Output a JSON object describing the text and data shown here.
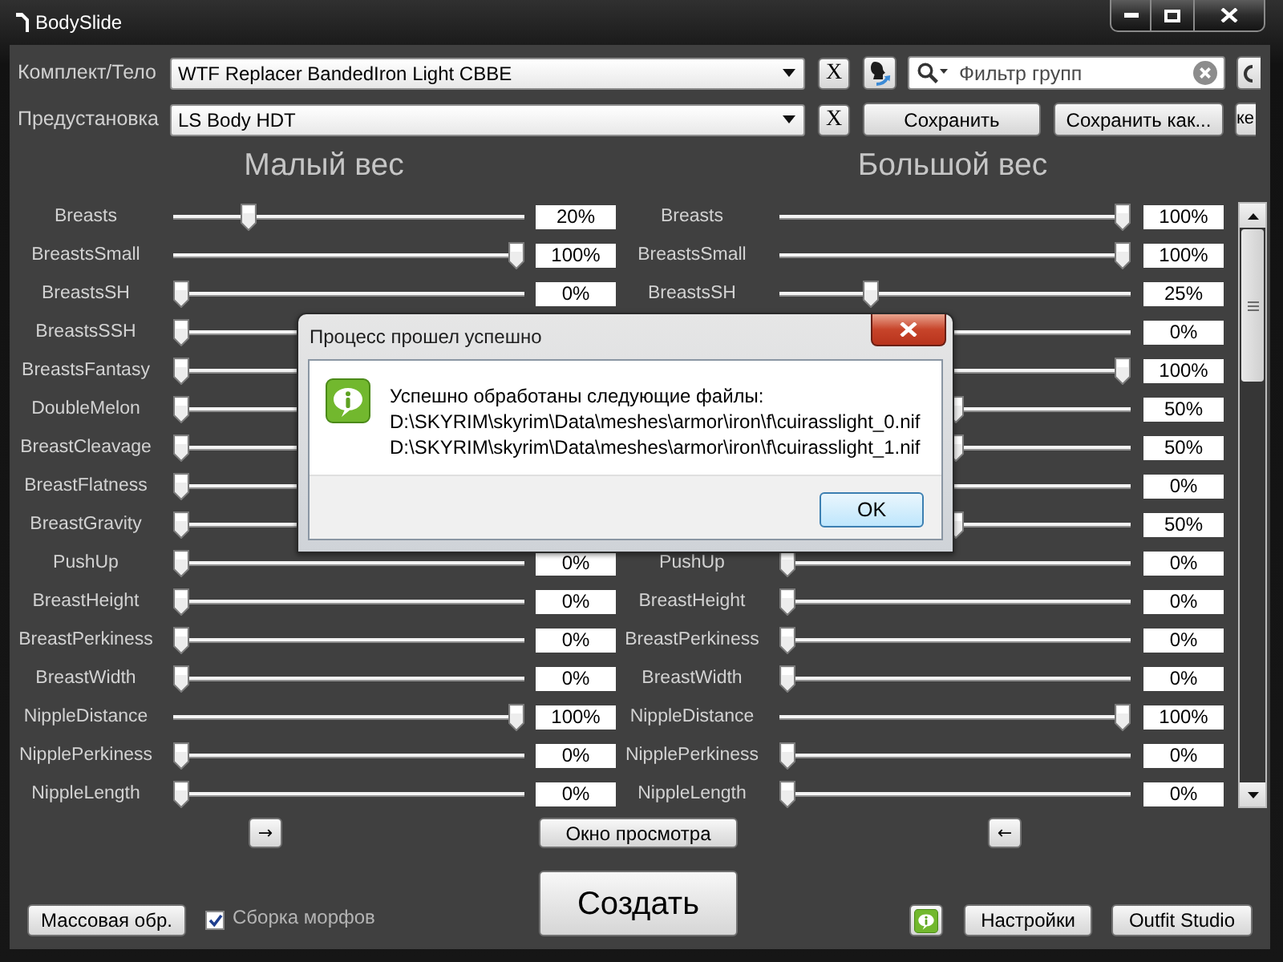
{
  "window": {
    "title": "BodySlide"
  },
  "outfit": {
    "label": "Комплект/Тело",
    "value": "WTF Replacer BandedIron Light CBBE",
    "clear_button": "X"
  },
  "group_filter": {
    "placeholder": "Фильтр групп"
  },
  "preset": {
    "label": "Предустановка",
    "value": "LS Body HDT",
    "clear_button": "X",
    "buttons": [
      "Сохранить",
      "Сохранить как...",
      "ке"
    ]
  },
  "column_headers": [
    "Малый вес",
    "Большой вес"
  ],
  "sliders": [
    {
      "low": {
        "label": "Breasts",
        "level": 0.2,
        "value": "20%"
      },
      "high": {
        "label": "Breasts",
        "level": 1,
        "value": "100%"
      }
    },
    {
      "low": {
        "label": "BreastsSmall",
        "level": 1,
        "value": "100%"
      },
      "high": {
        "label": "BreastsSmall",
        "level": 1,
        "value": "100%"
      }
    },
    {
      "low": {
        "label": "BreastsSH",
        "level": 0,
        "value": "0%"
      },
      "high": {
        "label": "BreastsSH",
        "level": 0.25,
        "value": "25%"
      }
    },
    {
      "low": {
        "label": "BreastsSSH",
        "level": 0
      },
      "high": {
        "level": 0,
        "value": "0%"
      }
    },
    {
      "low": {
        "label": "BreastsFantasy",
        "level": 0
      },
      "high": {
        "level": 1,
        "value": "100%"
      }
    },
    {
      "low": {
        "label": "DoubleMelon",
        "level": 0
      },
      "high": {
        "level": 0.5,
        "value": "50%"
      }
    },
    {
      "low": {
        "label": "BreastCleavage",
        "level": 0
      },
      "high": {
        "level": 0.5,
        "value": "50%"
      }
    },
    {
      "low": {
        "label": "BreastFlatness",
        "level": 0
      },
      "high": {
        "level": 0,
        "value": "0%"
      }
    },
    {
      "low": {
        "label": "BreastGravity",
        "level": 0
      },
      "high": {
        "level": 0.5,
        "value": "50%"
      }
    },
    {
      "low": {
        "label": "PushUp",
        "level": 0,
        "value": "0%"
      },
      "high": {
        "label": "PushUp",
        "level": 0,
        "value": "0%"
      }
    },
    {
      "low": {
        "label": "BreastHeight",
        "level": 0,
        "value": "0%"
      },
      "high": {
        "label": "BreastHeight",
        "level": 0,
        "value": "0%"
      }
    },
    {
      "low": {
        "label": "BreastPerkiness",
        "level": 0,
        "value": "0%"
      },
      "high": {
        "label": "BreastPerkiness",
        "level": 0,
        "value": "0%"
      }
    },
    {
      "low": {
        "label": "BreastWidth",
        "level": 0,
        "value": "0%"
      },
      "high": {
        "label": "BreastWidth",
        "level": 0,
        "value": "0%"
      }
    },
    {
      "low": {
        "label": "NippleDistance",
        "level": 1,
        "value": "100%"
      },
      "high": {
        "label": "NippleDistance",
        "level": 1,
        "value": "100%"
      }
    },
    {
      "low": {
        "label": "NipplePerkiness",
        "level": 0,
        "value": "0%"
      },
      "high": {
        "label": "NipplePerkiness",
        "level": 0,
        "value": "0%"
      }
    },
    {
      "low": {
        "label": "NippleLength",
        "level": 0,
        "value": "0%"
      },
      "high": {
        "label": "NippleLength",
        "level": 0,
        "value": "0%"
      }
    }
  ],
  "nav_buttons": [
    "→",
    "Окно просмотра",
    "←"
  ],
  "batch_button": "Массовая обр.",
  "build_morphs": {
    "label": "Сборка морфов",
    "checked": true
  },
  "build_button": "Создать",
  "bottom_buttons": [
    "Настройки",
    "Outfit Studio"
  ],
  "dialog": {
    "title": "Процесс прошел успешно",
    "message": "Успешно обработаны следующие файлы:",
    "files": [
      "D:\\SKYRIM\\skyrim\\Data\\meshes\\armor\\iron\\f\\cuirasslight_0.nif",
      "D:\\SKYRIM\\skyrim\\Data\\meshes\\armor\\iron\\f\\cuirasslight_1.nif"
    ],
    "button": "OK"
  }
}
